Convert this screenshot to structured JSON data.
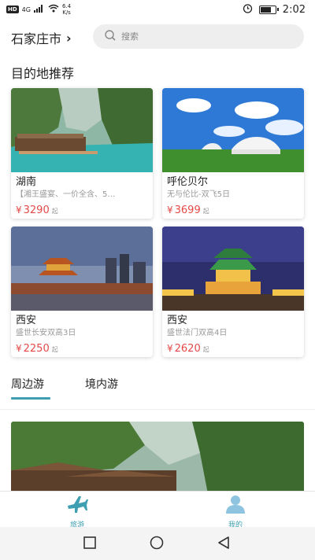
{
  "status_bar": {
    "hd": "HD",
    "signal": "4G",
    "net_speed_value": "6.4",
    "net_speed_unit": "K/s",
    "time": "2:02",
    "battery_level": 0.8
  },
  "header": {
    "city": "石家庄市",
    "search_placeholder": "搜索"
  },
  "section_title": "目的地推荐",
  "destinations": [
    {
      "name": "湖南",
      "desc": "【湘王盛宴、一价全含、5…",
      "price": "3290",
      "unit": "起"
    },
    {
      "name": "呼伦贝尔",
      "desc": "无与伦比-双飞5日",
      "price": "3699",
      "unit": "起"
    },
    {
      "name": "西安",
      "desc": "盛世长安双高3日",
      "price": "2250",
      "unit": "起"
    },
    {
      "name": "西安",
      "desc": "盛世法门双高4日",
      "price": "2620",
      "unit": "起"
    }
  ],
  "currency": "¥",
  "tabs": [
    {
      "label": "周边游",
      "active": true
    },
    {
      "label": "境内游",
      "active": false
    }
  ],
  "tabbar": [
    {
      "label": "旅游",
      "icon": "airplane-icon"
    },
    {
      "label": "我的",
      "icon": "person-icon"
    }
  ],
  "colors": {
    "accent": "#3e9fb2",
    "price": "#e54848"
  }
}
